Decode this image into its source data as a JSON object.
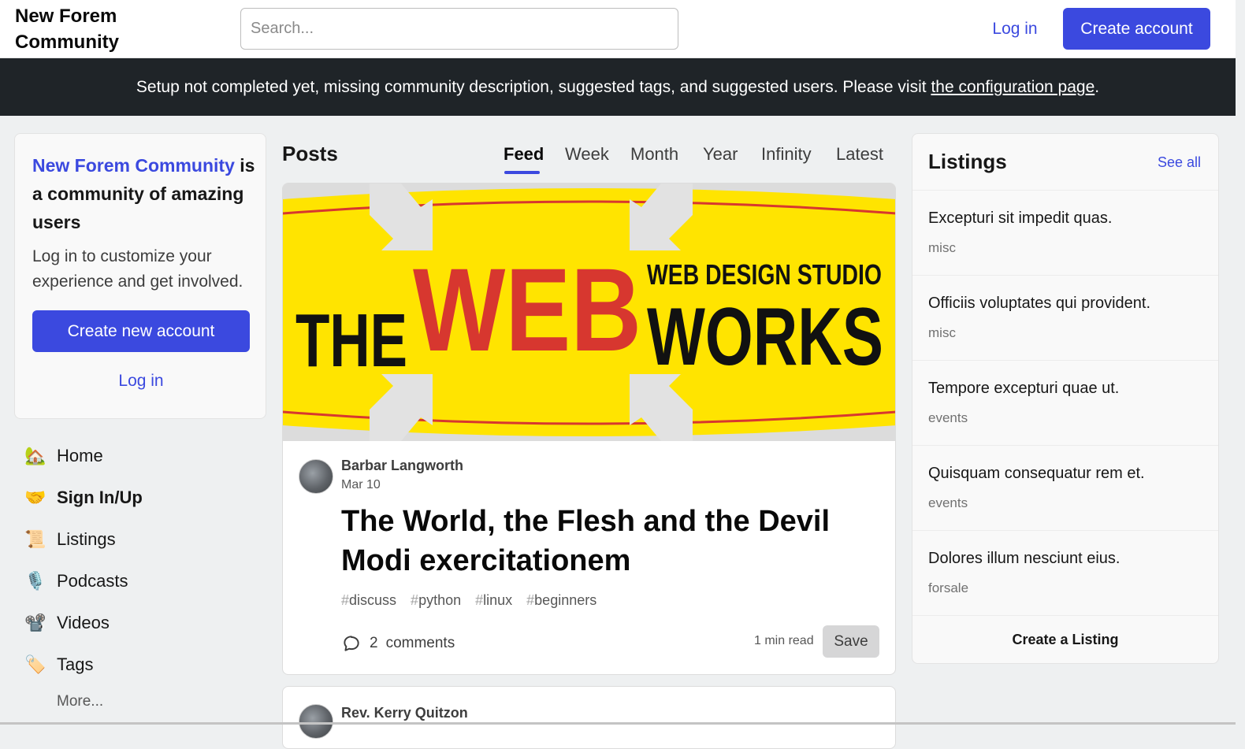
{
  "header": {
    "logo": "New Forem Community",
    "search_placeholder": "Search...",
    "login_label": "Log in",
    "create_account_label": "Create account"
  },
  "banner": {
    "text": "Setup not completed yet, missing community description, suggested tags, and suggested users. Please visit ",
    "link_text": "the configuration page",
    "suffix": "."
  },
  "intro": {
    "brand": "New Forem Community",
    "title_rest": " is a community of amazing users",
    "subtitle": "Log in to customize your experience and get involved.",
    "create_button": "Create new account",
    "login_link": "Log in"
  },
  "nav": {
    "items": [
      {
        "icon": "🏡",
        "icon_name": "house-icon",
        "label": "Home"
      },
      {
        "icon": "🤝",
        "icon_name": "handshake-icon",
        "label": "Sign In/Up"
      },
      {
        "icon": "📜",
        "icon_name": "scroll-icon",
        "label": "Listings"
      },
      {
        "icon": "🎙️",
        "icon_name": "microphone-icon",
        "label": "Podcasts"
      },
      {
        "icon": "📽️",
        "icon_name": "film-projector-icon",
        "label": "Videos"
      },
      {
        "icon": "🏷️",
        "icon_name": "label-icon",
        "label": "Tags"
      }
    ],
    "more": "More..."
  },
  "feed": {
    "heading": "Posts",
    "tabs": [
      "Feed",
      "Week",
      "Month",
      "Year",
      "Infinity",
      "Latest"
    ],
    "active_tab": "Feed"
  },
  "post": {
    "cover_text": {
      "the": "THE",
      "web": "WEB",
      "works": "WORKS",
      "tagline": "WEB DESIGN STUDIO"
    },
    "author": "Barbar Langworth",
    "date": "Mar 10",
    "title": "The World, the Flesh and the Devil Modi exercitationem",
    "tags": [
      "discuss",
      "python",
      "linux",
      "beginners"
    ],
    "comments_count": "2",
    "comments_label": "comments",
    "read_time": "1 min read",
    "save_label": "Save"
  },
  "post2": {
    "author": "Rev. Kerry Quitzon"
  },
  "listings": {
    "title": "Listings",
    "see_all": "See all",
    "items": [
      {
        "title": "Excepturi sit impedit quas.",
        "category": "misc"
      },
      {
        "title": "Officiis voluptates qui provident.",
        "category": "misc"
      },
      {
        "title": "Tempore excepturi quae ut.",
        "category": "events"
      },
      {
        "title": "Quisquam consequatur rem et.",
        "category": "events"
      },
      {
        "title": "Dolores illum nesciunt eius.",
        "category": "forsale"
      }
    ],
    "create_label": "Create a Listing"
  },
  "colors": {
    "accent": "#3b49df",
    "banner_bg": "#1f2428",
    "cover_yellow": "#ffe400",
    "cover_red": "#d7372f"
  }
}
